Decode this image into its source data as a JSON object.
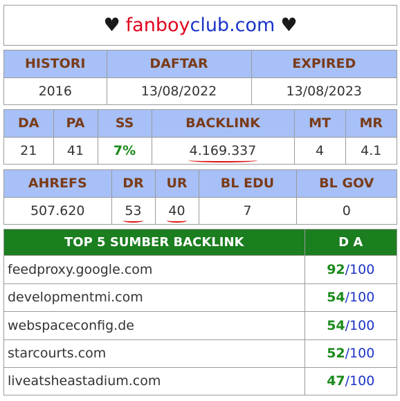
{
  "title": {
    "heart_left": "♥",
    "part1": "fanboy",
    "part2": "club.com",
    "heart_right": "♥"
  },
  "histori": {
    "headers": [
      "HISTORI",
      "DAFTAR",
      "EXPIRED"
    ],
    "values": [
      "2016",
      "13/08/2022",
      "13/08/2023"
    ]
  },
  "metrics": {
    "headers": [
      "DA",
      "PA",
      "SS",
      "BACKLINK",
      "MT",
      "MR"
    ],
    "values": [
      "21",
      "41",
      "7%",
      "4.169.337",
      "4",
      "4.1"
    ]
  },
  "ahrefs": {
    "headers": [
      "AHREFS",
      "DR",
      "UR",
      "BL EDU",
      "BL GOV"
    ],
    "values": [
      "507.620",
      "53",
      "40",
      "7",
      "0"
    ]
  },
  "sources": {
    "header_domain": "TOP 5 SUMBER BACKLINK",
    "header_da": "D A",
    "da_sep": "/",
    "da_max": "100",
    "rows": [
      {
        "domain": "feedproxy.google.com",
        "da": "92"
      },
      {
        "domain": "developmentmi.com",
        "da": "54"
      },
      {
        "domain": "webspaceconfig.de",
        "da": "54"
      },
      {
        "domain": "starcourts.com",
        "da": "52"
      },
      {
        "domain": "liveatsheastadium.com",
        "da": "47"
      }
    ]
  },
  "colors": {
    "header_blue": "#a7c0f7",
    "header_green": "#1b7e1f",
    "accent_red": "#e0001c",
    "accent_blue": "#1a34c8",
    "value_green": "#1a8a1a"
  }
}
